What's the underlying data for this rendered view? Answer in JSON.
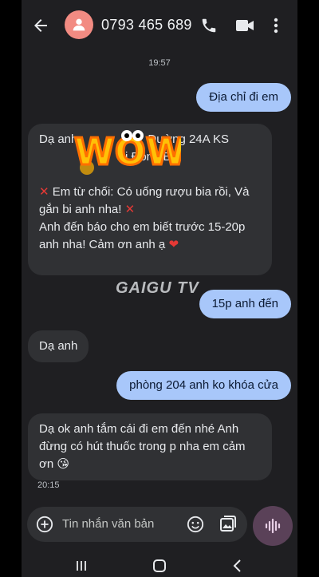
{
  "header": {
    "contact_number": "0793 465 689"
  },
  "conversation": {
    "time_top": "19:57",
    "messages": [
      {
        "dir": "out",
        "text": "Địa chỉ đi em"
      },
      {
        "dir": "in",
        "lines": [
          "Dạ anh",
          "Đường 24A KS",
          "ị Đông B,",
          "Em từ chối: Có uống rượu bia rồi, Và",
          "gắn bi anh nha!",
          "Anh đến báo cho em biết trước 15-20p",
          "anh nha! Cảm ơn anh ạ"
        ]
      },
      {
        "dir": "out",
        "text": "15p anh đến"
      },
      {
        "dir": "in",
        "text": "Dạ anh"
      },
      {
        "dir": "out",
        "text": "phòng 204 anh ko khóa cửa"
      },
      {
        "dir": "in",
        "lines": [
          "Dạ ok anh tắm cái đi em đến nhé Anh",
          "đừng có hút thuốc trong p nha em cảm",
          "ơn"
        ]
      }
    ],
    "time_bottom": "20:15"
  },
  "overlay": {
    "sticker_text": "WOW",
    "watermark": "GAIGU TV"
  },
  "composer": {
    "placeholder": "Tin nhắn văn bản"
  },
  "icons": [
    "back-arrow-icon",
    "person-icon",
    "phone-icon",
    "video-icon",
    "more-vert-icon",
    "add-icon",
    "emoji-icon",
    "gallery-icon",
    "voice-wave-icon"
  ],
  "colors": {
    "outgoing_bubble": "#a8c7fa",
    "incoming_bubble": "#303134",
    "background": "#1f1f22",
    "avatar": "#f28b82",
    "mic_button": "#5a4158"
  }
}
